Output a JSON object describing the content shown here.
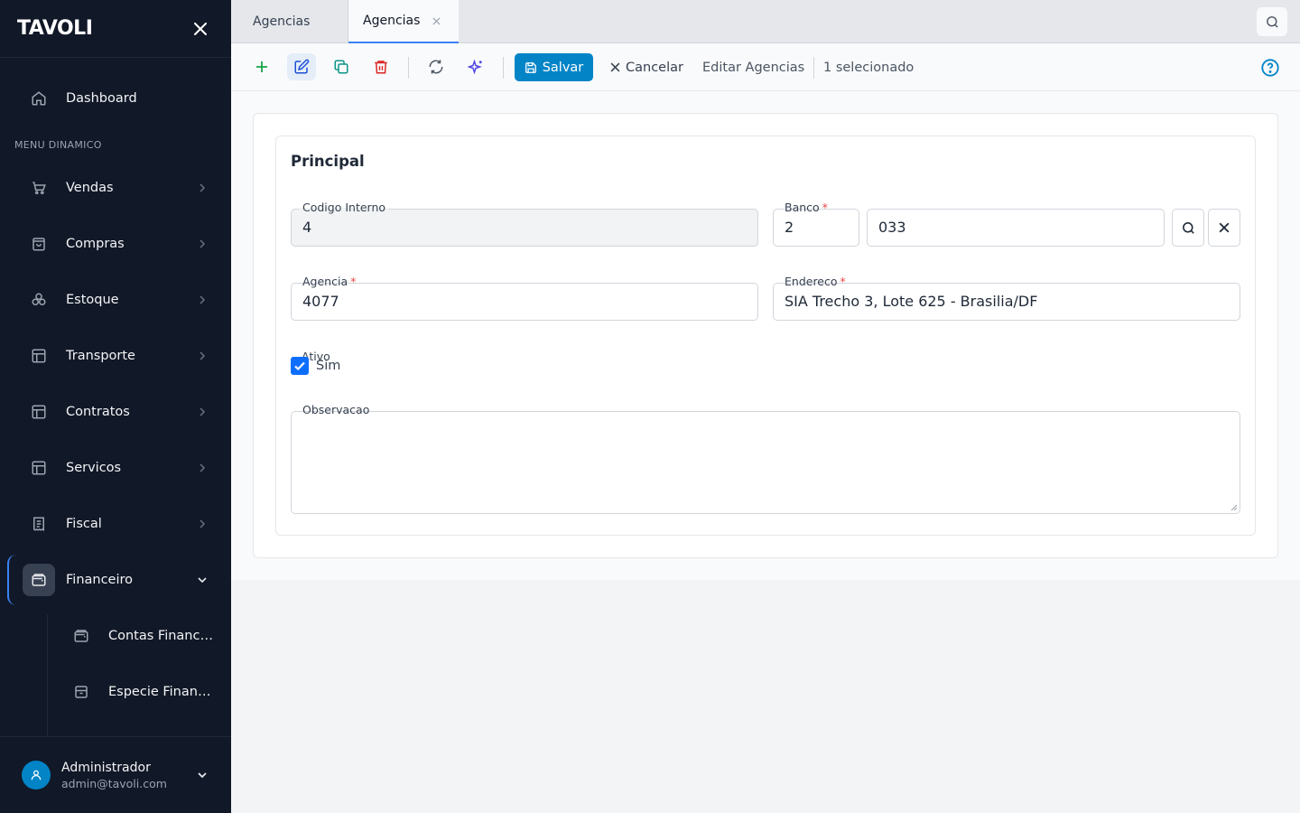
{
  "sidebar": {
    "logo": "TAVOLI",
    "dashboard_label": "Dashboard",
    "section_label": "MENU DINAMICO",
    "items": [
      {
        "label": "Vendas",
        "icon": "cart-icon"
      },
      {
        "label": "Compras",
        "icon": "bag-icon"
      },
      {
        "label": "Estoque",
        "icon": "boxes-icon"
      },
      {
        "label": "Transporte",
        "icon": "layout-icon"
      },
      {
        "label": "Contratos",
        "icon": "layout-icon"
      },
      {
        "label": "Servicos",
        "icon": "layout-icon"
      },
      {
        "label": "Fiscal",
        "icon": "receipt-icon"
      },
      {
        "label": "Financeiro",
        "icon": "wallet-icon"
      }
    ],
    "subitems": [
      {
        "label": "Contas Financeiras",
        "icon": "wallet-icon"
      },
      {
        "label": "Especie Financeira",
        "icon": "archive-icon"
      }
    ],
    "user": {
      "name": "Administrador",
      "email": "admin@tavoli.com"
    }
  },
  "tabs": [
    {
      "label": "Agencias"
    },
    {
      "label": "Agencias"
    }
  ],
  "toolbar": {
    "save_label": "Salvar",
    "cancel_label": "Cancelar",
    "context_label": "Editar Agencias",
    "selection_label": "1 selecionado"
  },
  "form": {
    "section_title": "Principal",
    "codigo_interno": {
      "label": "Codigo Interno",
      "value": "4"
    },
    "banco": {
      "label": "Banco",
      "code": "2",
      "value": "033"
    },
    "agencia": {
      "label": "Agencia",
      "value": "4077"
    },
    "endereco": {
      "label": "Endereco",
      "value": "SIA Trecho 3, Lote 625 - Brasilia/DF"
    },
    "ativo": {
      "label": "Ativo",
      "text": "Sim",
      "checked": true
    },
    "observacao": {
      "label": "Observacao",
      "value": ""
    }
  },
  "colors": {
    "sidebar_bg": "#111827",
    "primary": "#0284c7",
    "add": "#16a34a",
    "delete": "#dc2626",
    "duplicate": "#0d9488",
    "ai": "#4f46e5"
  }
}
